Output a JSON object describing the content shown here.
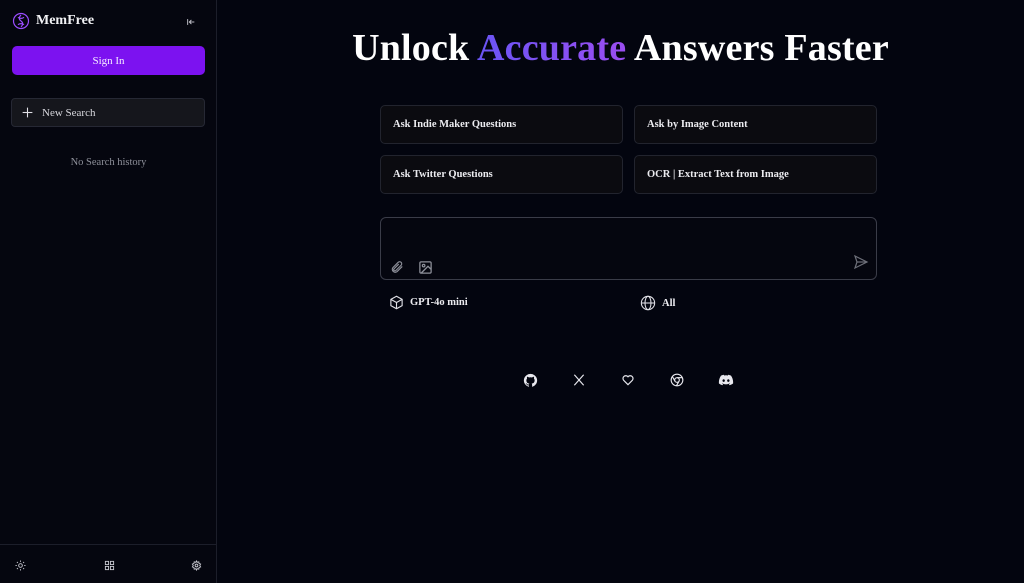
{
  "sidebar": {
    "brand_name": "MemFree",
    "sign_in_label": "Sign In",
    "new_search_label": "New Search",
    "empty_history_text": "No Search history",
    "footer_icons": [
      "sun-icon",
      "grid-icon",
      "gear-icon"
    ]
  },
  "main": {
    "headline": {
      "before": "Unlock ",
      "accent": "Accurate",
      "after": " Answers Faster"
    },
    "suggestions": [
      "Ask Indie Maker Questions",
      "Ask by Image Content",
      "Ask Twitter Questions",
      "OCR | Extract Text from Image"
    ],
    "composer": {
      "value": "",
      "placeholder": ""
    },
    "model_label": "GPT-4o mini",
    "source_label": "All",
    "social_icons": [
      "github-icon",
      "x-icon",
      "heart-icon",
      "chrome-icon",
      "discord-icon"
    ]
  },
  "colors": {
    "background": "#03050f",
    "primary_button": "#7c12f0",
    "accent_gradient_start": "#6a55f5",
    "accent_gradient_end": "#9a4df0"
  }
}
